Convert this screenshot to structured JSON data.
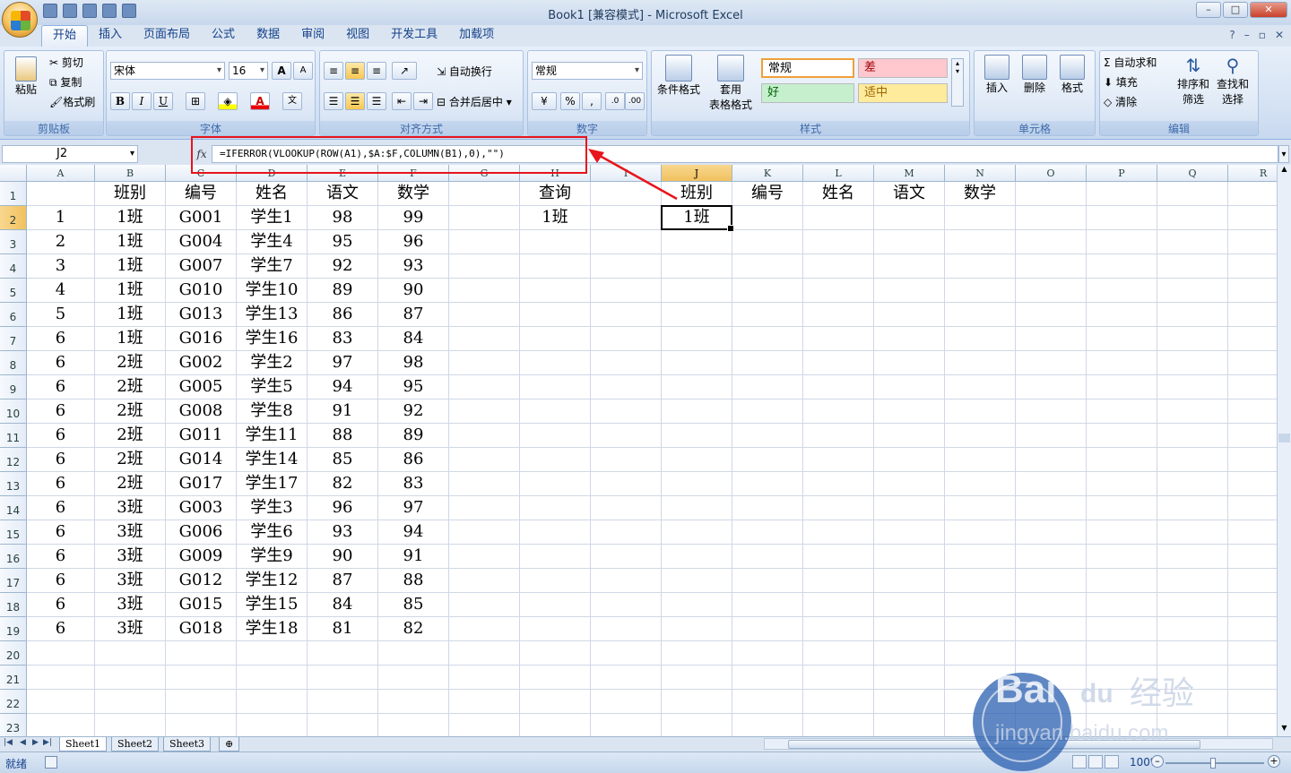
{
  "window": {
    "title": "Book1  [兼容模式] - Microsoft Excel",
    "min": "–",
    "max": "□",
    "close": "✕"
  },
  "tabs": [
    "开始",
    "插入",
    "页面布局",
    "公式",
    "数据",
    "审阅",
    "视图",
    "开发工具",
    "加载项"
  ],
  "active_tab": "开始",
  "ribbon": {
    "clipboard": {
      "label": "剪贴板",
      "paste": "粘贴",
      "cut": "剪切",
      "copy": "复制",
      "format_painter": "格式刷"
    },
    "font": {
      "label": "字体",
      "font_name": "宋体",
      "font_size": "16",
      "grow": "A",
      "shrink": "A",
      "bold": "B",
      "italic": "I",
      "underline": "U"
    },
    "alignment": {
      "label": "对齐方式",
      "wrap": "自动换行",
      "merge": "合并后居中"
    },
    "number": {
      "label": "数字",
      "format": "常规",
      "percent": "%",
      "comma": ","
    },
    "styles": {
      "label": "样式",
      "conditional": "条件格式",
      "table": "套用",
      "table2": "表格格式",
      "normal": "常规",
      "bad": "差",
      "good": "好",
      "neutral": "适中"
    },
    "cells": {
      "label": "单元格",
      "insert": "插入",
      "delete": "删除",
      "format": "格式"
    },
    "editing": {
      "label": "编辑",
      "autosum": "自动求和",
      "fill": "填充",
      "clear": "清除",
      "sort": "排序和",
      "sort2": "筛选",
      "find": "查找和",
      "find2": "选择"
    }
  },
  "formula_bar": {
    "name_box": "J2",
    "fx": "fx",
    "formula": "=IFERROR(VLOOKUP(ROW(A1),$A:$F,COLUMN(B1),0),\"\")"
  },
  "columns": [
    "A",
    "B",
    "C",
    "D",
    "E",
    "F",
    "G",
    "H",
    "I",
    "J",
    "K",
    "L",
    "M",
    "N",
    "O",
    "P",
    "Q",
    "R"
  ],
  "selected_column": "J",
  "selected_row": 2,
  "rows": [
    "1",
    "2",
    "3",
    "4",
    "5",
    "6",
    "7",
    "8",
    "9",
    "10",
    "11",
    "12",
    "13",
    "14",
    "15",
    "16",
    "17",
    "18",
    "19",
    "20",
    "21",
    "22",
    "23"
  ],
  "table_headers": [
    "",
    "班别",
    "编号",
    "姓名",
    "语文",
    "数学"
  ],
  "table_rows": [
    [
      "1",
      "1班",
      "G001",
      "学生1",
      "98",
      "99"
    ],
    [
      "2",
      "1班",
      "G004",
      "学生4",
      "95",
      "96"
    ],
    [
      "3",
      "1班",
      "G007",
      "学生7",
      "92",
      "93"
    ],
    [
      "4",
      "1班",
      "G010",
      "学生10",
      "89",
      "90"
    ],
    [
      "5",
      "1班",
      "G013",
      "学生13",
      "86",
      "87"
    ],
    [
      "6",
      "1班",
      "G016",
      "学生16",
      "83",
      "84"
    ],
    [
      "6",
      "2班",
      "G002",
      "学生2",
      "97",
      "98"
    ],
    [
      "6",
      "2班",
      "G005",
      "学生5",
      "94",
      "95"
    ],
    [
      "6",
      "2班",
      "G008",
      "学生8",
      "91",
      "92"
    ],
    [
      "6",
      "2班",
      "G011",
      "学生11",
      "88",
      "89"
    ],
    [
      "6",
      "2班",
      "G014",
      "学生14",
      "85",
      "86"
    ],
    [
      "6",
      "2班",
      "G017",
      "学生17",
      "82",
      "83"
    ],
    [
      "6",
      "3班",
      "G003",
      "学生3",
      "96",
      "97"
    ],
    [
      "6",
      "3班",
      "G006",
      "学生6",
      "93",
      "94"
    ],
    [
      "6",
      "3班",
      "G009",
      "学生9",
      "90",
      "91"
    ],
    [
      "6",
      "3班",
      "G012",
      "学生12",
      "87",
      "88"
    ],
    [
      "6",
      "3班",
      "G015",
      "学生15",
      "84",
      "85"
    ],
    [
      "6",
      "3班",
      "G018",
      "学生18",
      "81",
      "82"
    ]
  ],
  "query": {
    "label": "查询",
    "value": "1班"
  },
  "result_headers": [
    "班别",
    "编号",
    "姓名",
    "语文",
    "数学"
  ],
  "result_value": "1班",
  "sheets": [
    "Sheet1",
    "Sheet2",
    "Sheet3"
  ],
  "active_sheet": "Sheet1",
  "status": {
    "ready": "就绪",
    "zoom": "100%"
  },
  "watermark": {
    "brand": "Bai",
    "brand2": "du",
    "product": "经验",
    "url": "jingyan.baidu.com"
  },
  "colors": {
    "highlight": "#e8141b",
    "selected_header": "#f1c15f"
  }
}
